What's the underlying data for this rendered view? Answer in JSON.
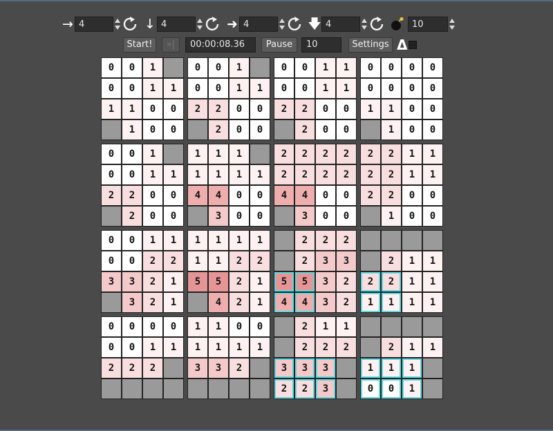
{
  "controls": {
    "dims": [
      {
        "arrow": "→",
        "icon": "arrow-right-icon",
        "value": "4"
      },
      {
        "arrow": "↓",
        "icon": "arrow-down-icon",
        "value": "4"
      },
      {
        "arrow": "➜",
        "icon": "arrow-right-bold-icon",
        "value": "4"
      },
      {
        "arrow": "🡇",
        "icon": "arrow-down-bold-icon",
        "value": "4"
      }
    ],
    "mines": "10",
    "start_label": "Start!",
    "hint_label": "»|",
    "timer": "00:00:08.36",
    "pause_label": "Pause",
    "speed": "10",
    "settings_label": "Settings",
    "delta_symbol": "Δ"
  },
  "colors": {
    "background": "#4a4a4a",
    "closed_cell": "#9a9a9a",
    "selection": "#5fd8e0",
    "heat": [
      "#ffffff",
      "#fdf1f1",
      "#f8dede",
      "#f3c9c9",
      "#eeaeae",
      "#e59595"
    ]
  },
  "board": {
    "rows": [
      [
        "0",
        "0",
        "1",
        "#",
        "0",
        "0",
        "1",
        "#",
        "0",
        "0",
        "1",
        "1",
        "0",
        "0",
        "0",
        "0"
      ],
      [
        "0",
        "0",
        "1",
        "1",
        "0",
        "0",
        "1",
        "1",
        "0",
        "0",
        "1",
        "1",
        "0",
        "0",
        "0",
        "0"
      ],
      [
        "1",
        "1",
        "0",
        "0",
        "2",
        "2",
        "0",
        "0",
        "2",
        "2",
        "0",
        "0",
        "1",
        "1",
        "0",
        "0"
      ],
      [
        "#",
        "1",
        "0",
        "0",
        "#",
        "2",
        "0",
        "0",
        "#",
        "2",
        "0",
        "0",
        "#",
        "1",
        "0",
        "0"
      ],
      [
        "0",
        "0",
        "1",
        "#",
        "1",
        "1",
        "1",
        "#",
        "2",
        "2",
        "2",
        "2",
        "2",
        "2",
        "1",
        "1"
      ],
      [
        "0",
        "0",
        "1",
        "1",
        "1",
        "1",
        "1",
        "1",
        "2",
        "2",
        "2",
        "2",
        "2",
        "2",
        "1",
        "1"
      ],
      [
        "2",
        "2",
        "0",
        "0",
        "4",
        "4",
        "0",
        "0",
        "4",
        "4",
        "0",
        "0",
        "2",
        "2",
        "0",
        "0"
      ],
      [
        "#",
        "2",
        "0",
        "0",
        "#",
        "3",
        "0",
        "0",
        "#",
        "3",
        "0",
        "0",
        "#",
        "1",
        "0",
        "0"
      ],
      [
        "0",
        "0",
        "1",
        "1",
        "1",
        "1",
        "1",
        "1",
        "#",
        "2",
        "2",
        "2",
        "#",
        "#",
        "#",
        "#"
      ],
      [
        "0",
        "0",
        "2",
        "2",
        "1",
        "1",
        "2",
        "2",
        "#",
        "2",
        "3",
        "3",
        "#",
        "2",
        "1",
        "1"
      ],
      [
        "3",
        "3",
        "2",
        "1",
        "5",
        "5",
        "2",
        "1",
        "5",
        "5",
        "3",
        "2",
        "2",
        "2",
        "1",
        "1"
      ],
      [
        "#",
        "3",
        "2",
        "1",
        "#",
        "4",
        "2",
        "1",
        "4",
        "4",
        "3",
        "2",
        "1",
        "1",
        "1",
        "1"
      ],
      [
        "0",
        "0",
        "0",
        "0",
        "1",
        "1",
        "0",
        "0",
        "#",
        "2",
        "1",
        "1",
        "#",
        "#",
        "#",
        "#"
      ],
      [
        "0",
        "0",
        "1",
        "1",
        "1",
        "1",
        "1",
        "1",
        "#",
        "2",
        "2",
        "2",
        "#",
        "2",
        "1",
        "1"
      ],
      [
        "2",
        "2",
        "2",
        "#",
        "3",
        "3",
        "2",
        "#",
        "3",
        "3",
        "3",
        "#",
        "1",
        "1",
        "1",
        "#"
      ],
      [
        "#",
        "#",
        "#",
        "#",
        "#",
        "#",
        "#",
        "#",
        "2",
        "2",
        "3",
        "#",
        "0",
        "0",
        "1",
        "#"
      ]
    ],
    "selected": [
      [
        10,
        8
      ],
      [
        10,
        9
      ],
      [
        11,
        8
      ],
      [
        11,
        9
      ],
      [
        10,
        12
      ],
      [
        10,
        13
      ],
      [
        11,
        12
      ],
      [
        11,
        13
      ],
      [
        14,
        8
      ],
      [
        14,
        9
      ],
      [
        14,
        10
      ],
      [
        15,
        8
      ],
      [
        15,
        9
      ],
      [
        15,
        10
      ],
      [
        14,
        12
      ],
      [
        14,
        13
      ],
      [
        14,
        14
      ],
      [
        15,
        12
      ],
      [
        15,
        13
      ],
      [
        15,
        14
      ]
    ]
  }
}
